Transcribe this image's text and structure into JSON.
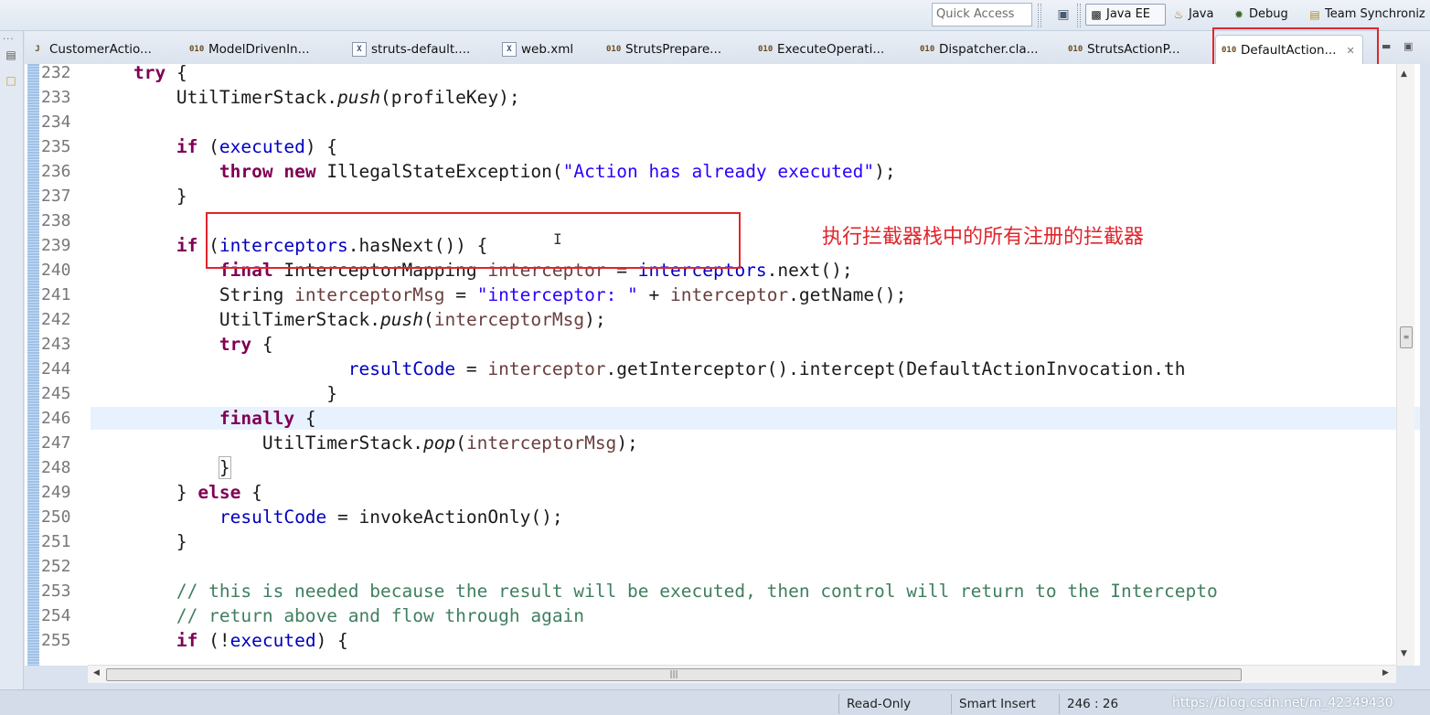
{
  "toolbar": {
    "quick_access_placeholder": "Quick Access",
    "perspectives": [
      {
        "label": "Java EE",
        "icon": "java-ee-perspective-icon",
        "active": true
      },
      {
        "label": "Java",
        "icon": "java-perspective-icon",
        "active": false
      },
      {
        "label": "Debug",
        "icon": "bug-icon",
        "active": false
      },
      {
        "label": "Team Synchroniz",
        "icon": "team-sync-icon",
        "active": false
      }
    ]
  },
  "tabs": [
    {
      "label": "CustomerActio...",
      "icon": "java-class-icon"
    },
    {
      "label": "ModelDrivenIn...",
      "icon": "class-file-icon"
    },
    {
      "label": "struts-default....",
      "icon": "xml-file-icon"
    },
    {
      "label": "web.xml",
      "icon": "xml-file-icon"
    },
    {
      "label": "StrutsPrepare...",
      "icon": "class-file-icon"
    },
    {
      "label": "ExecuteOperati...",
      "icon": "class-file-icon"
    },
    {
      "label": "Dispatcher.cla...",
      "icon": "class-file-icon"
    },
    {
      "label": "StrutsActionP...",
      "icon": "class-file-icon"
    },
    {
      "label": "DefaultAction...",
      "icon": "class-file-icon",
      "active": true
    }
  ],
  "editor": {
    "current_line": "246",
    "lines": [
      {
        "num": "232"
      },
      {
        "num": "233"
      },
      {
        "num": "234"
      },
      {
        "num": "235"
      },
      {
        "num": "236"
      },
      {
        "num": "237"
      },
      {
        "num": "238"
      },
      {
        "num": "239"
      },
      {
        "num": "240"
      },
      {
        "num": "241"
      },
      {
        "num": "242"
      },
      {
        "num": "243"
      },
      {
        "num": "244"
      },
      {
        "num": "245"
      },
      {
        "num": "246"
      },
      {
        "num": "247"
      },
      {
        "num": "248"
      },
      {
        "num": "249"
      },
      {
        "num": "250"
      },
      {
        "num": "251"
      },
      {
        "num": "252"
      },
      {
        "num": "253"
      },
      {
        "num": "254"
      },
      {
        "num": "255"
      }
    ],
    "tokens": {
      "try": "try",
      "brace_open": " {",
      "util": "UtilTimerStack.",
      "push": "push",
      "profile_key": "(profileKey);",
      "if": "if",
      "paren_open": " (",
      "executed": "executed",
      "paren_close_brace": ") {",
      "throw": "throw",
      "new": "new",
      "ise": " IllegalStateException(",
      "ise_msg": "\"Action has already executed\"",
      "close_paren_semi": ");",
      "close_brace": "}",
      "interceptors": "interceptors",
      "has_next": ".hasNext()) {",
      "final": "final",
      "mapping_type": " InterceptorMapping ",
      "interceptor": "interceptor",
      "assign": " = ",
      "next": ".next();",
      "string_type": "String ",
      "interceptor_msg": "interceptorMsg",
      "interceptor_lit": "\"interceptor: \"",
      "plus": " + ",
      "get_name": ".getName();",
      "paren_l": "(",
      "paren_r_semi": ");",
      "result_code": "resultCode",
      "intercept_call": ".getInterceptor().intercept(DefaultActionInvocation.th",
      "finally": "finally",
      "pop": "pop",
      "else_kw": "else",
      "close_brace_space": "} ",
      "invoke_only": "invokeActionOnly();",
      "comment_1": "// this is needed because the result will be executed, then control will return to the Intercepto",
      "comment_2": "// return above and flow through again",
      "not_executed_open": " (!",
      "not_executed_close": ") {"
    }
  },
  "annotation": {
    "text": "执行拦截器栈中的所有注册的拦截器",
    "color": "#e0252c"
  },
  "status": {
    "mode": "Read-Only",
    "insert": "Smart Insert",
    "position": "246 : 26",
    "watermark": "https://blog.csdn.net/m_42349430"
  },
  "colors": {
    "keyword": "#7f0055",
    "field": "#0000c0",
    "string": "#2a00ff",
    "comment": "#3f7f5f",
    "highlight_box": "#e0252c"
  }
}
